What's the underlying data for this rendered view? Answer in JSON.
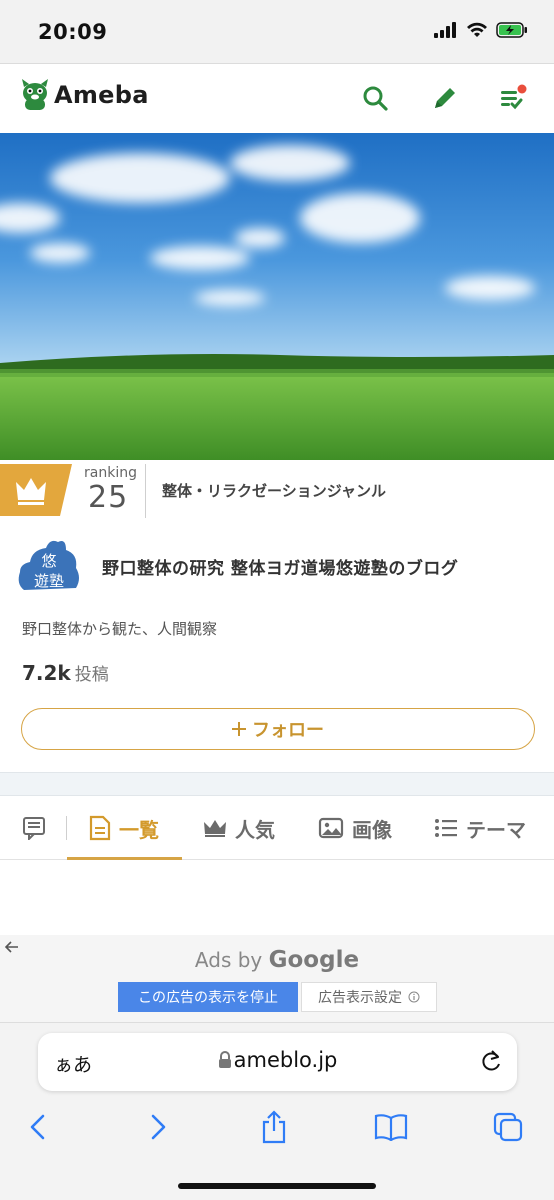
{
  "status": {
    "time": "20:09"
  },
  "header": {
    "logo": "Ameba"
  },
  "ranking": {
    "label": "ranking",
    "number": "25",
    "genre": "整体・リラクゼーションジャンル"
  },
  "blog": {
    "avatar_text": "悠遊塾",
    "title": "野口整体の研究 整体ヨガ道場悠遊塾のブログ",
    "description": "野口整体から観た、人間観察",
    "post_count": "7.2k",
    "post_label": "投稿",
    "follow_label": "フォロー"
  },
  "tabs": [
    {
      "label": "一覧",
      "icon": "document-icon",
      "active": true
    },
    {
      "label": "人気",
      "icon": "crown-icon",
      "active": false
    },
    {
      "label": "画像",
      "icon": "image-icon",
      "active": false
    },
    {
      "label": "テーマ",
      "icon": "list-icon",
      "active": false
    }
  ],
  "ad": {
    "ads_by": "Ads by",
    "google": "Google",
    "stop_label": "この広告の表示を停止",
    "settings_label": "広告表示設定"
  },
  "safari": {
    "aa": "ぁあ",
    "url": "ameblo.jp"
  },
  "colors": {
    "accent": "#d6a445",
    "ameba_green": "#2d8a3e",
    "ad_blue": "#4a86e8"
  }
}
